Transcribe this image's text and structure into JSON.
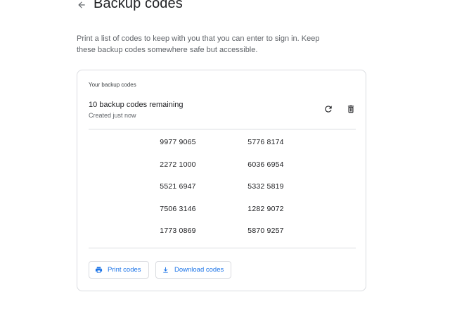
{
  "header": {
    "title": "Backup codes"
  },
  "description": "Print a list of codes to keep with you that you can enter to sign in. Keep these backup codes somewhere safe but accessible.",
  "card": {
    "section_label": "Your backup codes",
    "remaining": "10 backup codes remaining",
    "created": "Created just now",
    "codes": [
      [
        "9977 9065",
        "5776 8174"
      ],
      [
        "2272 1000",
        "6036 6954"
      ],
      [
        "5521 6947",
        "5332 5819"
      ],
      [
        "7506 3146",
        "1282 9072"
      ],
      [
        "1773 0869",
        "5870 9257"
      ]
    ],
    "buttons": {
      "print": "Print codes",
      "download": "Download codes"
    }
  },
  "colors": {
    "accent": "#1a73e8",
    "text": "#202124",
    "secondary": "#5f6368",
    "border": "#dadce0"
  },
  "icons": {
    "back": "arrow-back-icon",
    "refresh": "refresh-icon",
    "delete": "trash-icon",
    "print": "printer-icon",
    "download": "download-icon"
  }
}
